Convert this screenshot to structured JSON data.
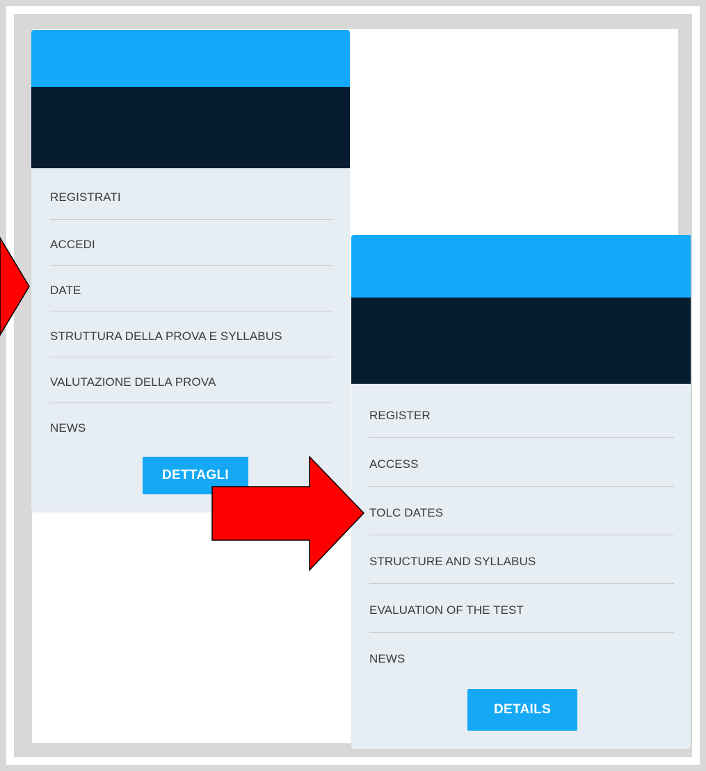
{
  "italian_card": {
    "menu": [
      {
        "label": "REGISTRATI"
      },
      {
        "label": "ACCEDI"
      },
      {
        "label": "DATE"
      },
      {
        "label": "STRUTTURA DELLA PROVA E SYLLABUS"
      },
      {
        "label": "VALUTAZIONE DELLA PROVA"
      },
      {
        "label": "NEWS"
      }
    ],
    "button_label": "DETTAGLI"
  },
  "english_card": {
    "menu": [
      {
        "label": "REGISTER"
      },
      {
        "label": "ACCESS"
      },
      {
        "label": "TOLC DATES"
      },
      {
        "label": "STRUCTURE AND SYLLABUS"
      },
      {
        "label": "EVALUATION OF THE TEST"
      },
      {
        "label": "NEWS"
      }
    ],
    "button_label": "DETAILS"
  },
  "colors": {
    "header_blue": "#13aafb",
    "header_dark": "#071c30",
    "menu_background": "#e6edf3",
    "button_blue": "#15a9f5",
    "arrow_red": "#ff0000",
    "frame_gray": "#d8d8d8"
  },
  "annotations": {
    "arrow_left_icon": "red-arrow-right-icon",
    "arrow_right_icon": "red-arrow-right-icon"
  }
}
